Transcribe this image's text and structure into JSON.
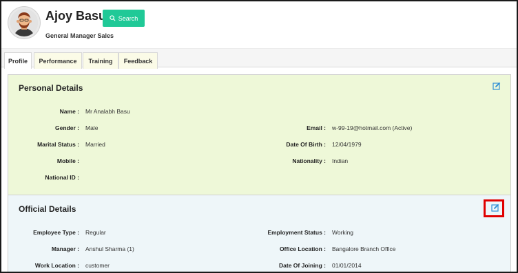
{
  "profile": {
    "name": "Ajoy Basu",
    "designation": "General Manager Sales",
    "search_label": "Search"
  },
  "tabs": [
    {
      "label": "Profile"
    },
    {
      "label": "Performance"
    },
    {
      "label": "Training"
    },
    {
      "label": "Feedback"
    }
  ],
  "personal": {
    "title": "Personal Details",
    "fields": {
      "name": {
        "label": "Name :",
        "value": "Mr Analabh Basu"
      },
      "gender": {
        "label": "Gender :",
        "value": "Male"
      },
      "email": {
        "label": "Email :",
        "value": "w-99-19@hotmail.com (Active)"
      },
      "marital": {
        "label": "Marital Status :",
        "value": "Married"
      },
      "dob": {
        "label": "Date Of Birth :",
        "value": "12/04/1979"
      },
      "mobile": {
        "label": "Mobile :",
        "value": ""
      },
      "nationality": {
        "label": "Nationality :",
        "value": "Indian"
      },
      "national_id": {
        "label": "National ID :",
        "value": ""
      }
    }
  },
  "official": {
    "title": "Official Details",
    "fields": {
      "employee_type": {
        "label": "Employee Type :",
        "value": "Regular"
      },
      "employment_status": {
        "label": "Employment Status :",
        "value": "Working"
      },
      "manager": {
        "label": "Manager :",
        "value": "Anshul Sharma (1)"
      },
      "office_location": {
        "label": "Office Location :",
        "value": "Bangalore Branch Office"
      },
      "work_location": {
        "label": "Work Location :",
        "value": "customer"
      },
      "date_of_joining": {
        "label": "Date Of Joining :",
        "value": "01/01/2014"
      }
    }
  },
  "colors": {
    "accent": "#20c997",
    "edit_icon": "#2f8fd6",
    "highlight": "#e00000",
    "personal_bg": "#eef8d8",
    "official_bg": "#eef6f9"
  }
}
